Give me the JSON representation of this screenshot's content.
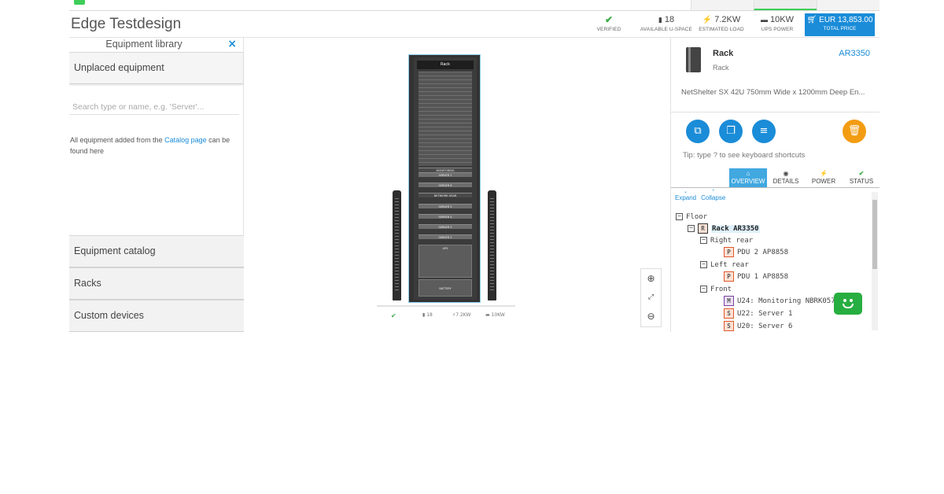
{
  "header": {
    "project_title": "Edge Testdesign",
    "stats": [
      {
        "value": "",
        "label": "VERIFIED",
        "icon": "check-icon"
      },
      {
        "value": "18",
        "label": "AVAILABLE U-SPACE",
        "icon": "rack-space-icon"
      },
      {
        "value": "7.2KW",
        "label": "ESTIMATED LOAD",
        "icon": "bolt-icon"
      },
      {
        "value": "10KW",
        "label": "UPS POWER",
        "icon": "battery-icon"
      }
    ],
    "total_price": {
      "value": "EUR 13,853.00",
      "label": "TOTAL PRICE",
      "icon": "cart-icon"
    }
  },
  "left_panel": {
    "library_title": "Equipment library",
    "close_icon": "×",
    "unplaced_label": "Unplaced equipment",
    "search_placeholder": "Search type or name, e.g. 'Server'...",
    "hint_prefix": "All equipment added from the ",
    "hint_link": "Catalog page",
    "hint_suffix": " can be found here",
    "sections": [
      "Equipment catalog",
      "Racks",
      "Custom devices"
    ]
  },
  "canvas": {
    "rack_label": "Rack",
    "devices": [
      {
        "label": "MONITORING"
      },
      {
        "label": "SERVER 1"
      },
      {
        "label": "SERVER 6"
      },
      {
        "label": "NETWORK GEAR"
      },
      {
        "label": "SERVER 5"
      },
      {
        "label": "SERVER 4"
      },
      {
        "label": "SERVER 3"
      },
      {
        "label": "SERVER 2"
      },
      {
        "label": "UPS"
      },
      {
        "label": "BATTERY"
      }
    ],
    "caption": {
      "space": "18",
      "load": "7.2KW",
      "ups": "10KW"
    },
    "zoom_controls": [
      "zoom-in-icon",
      "fit-icon",
      "zoom-out-icon"
    ]
  },
  "right_panel": {
    "item_name": "Rack",
    "item_type": "Rack",
    "item_model": "AR3350",
    "item_description": "NetShelter SX 42U 750mm Wide x 1200mm Deep En...",
    "actions": [
      "copy-icon",
      "duplicate-icon",
      "list-icon",
      "trash-icon"
    ],
    "tip": "Tip: type ? to see keyboard shortcuts",
    "tabs": [
      {
        "label": "OVERVIEW",
        "icon": "home-icon",
        "active": true
      },
      {
        "label": "DETAILS",
        "icon": "eye-icon",
        "active": false
      },
      {
        "label": "POWER",
        "icon": "bolt-icon",
        "active": false
      },
      {
        "label": "STATUS",
        "icon": "check-icon",
        "active": false
      }
    ],
    "tree_tools": [
      "Expand",
      "Collapse"
    ],
    "tree": {
      "floor": "Floor",
      "rack": {
        "badge": "R",
        "label": "Rack AR3350"
      },
      "right_rear": "Right rear",
      "pdu2": {
        "badge": "P",
        "label": "PDU 2 AP8858"
      },
      "left_rear": "Left rear",
      "pdu1": {
        "badge": "P",
        "label": "PDU 1 AP8858"
      },
      "front": "Front",
      "u24": {
        "badge": "M",
        "label": "U24:  Monitoring NBRK0570"
      },
      "u22": {
        "badge": "S",
        "label": "U22:  Server 1"
      },
      "u20": {
        "badge": "S",
        "label": "U20:  Server 6"
      }
    }
  },
  "colors": {
    "accent": "#1a8cd8",
    "brand_green": "#3dcd58",
    "warning": "#f39c12"
  }
}
